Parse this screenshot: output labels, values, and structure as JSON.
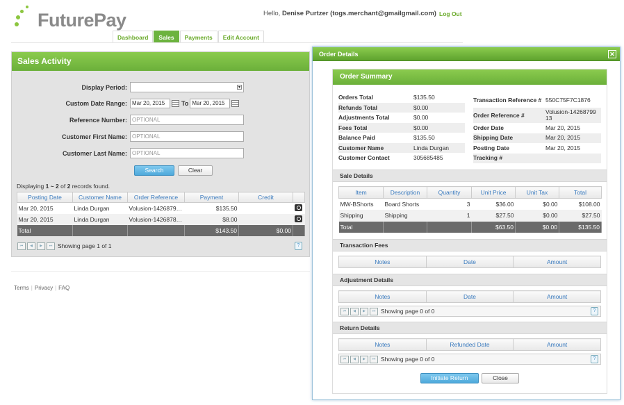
{
  "brand": {
    "logo_text": "FuturePay"
  },
  "header": {
    "greeting_prefix": "Hello,",
    "user": "Denise Purtzer (togs.merchant@gmailgmail.com)",
    "logout": "Log Out"
  },
  "nav": [
    {
      "label": "Dashboard",
      "active": false
    },
    {
      "label": "Sales",
      "active": true
    },
    {
      "label": "Payments",
      "active": false
    },
    {
      "label": "Edit Account",
      "active": false
    }
  ],
  "sales": {
    "title": "Sales Activity",
    "display_period_label": "Display Period:",
    "display_period_value": "",
    "date_range_label": "Custom Date Range:",
    "date_from": "Mar 20, 2015",
    "to_label": "To",
    "date_to": "Mar 20, 2015",
    "ref_label": "Reference Number:",
    "first_label": "Customer First Name:",
    "last_label": "Customer Last Name:",
    "placeholder": "OPTIONAL",
    "search": "Search",
    "clear": "Clear",
    "records_prefix": "Displaying",
    "records_range": "1 ~ 2",
    "records_of": "of",
    "records_total": "2",
    "records_suffix": "records found.",
    "columns": [
      "Posting Date",
      "Customer Name",
      "Order Reference",
      "Payment",
      "Credit"
    ],
    "rows": [
      {
        "date": "Mar 20, 2015",
        "customer": "Linda Durgan",
        "ref": "Volusion-1426879…",
        "payment": "$135.50",
        "credit": ""
      },
      {
        "date": "Mar 20, 2015",
        "customer": "Linda Durgan",
        "ref": "Volusion-1426878…",
        "payment": "$8.00",
        "credit": ""
      }
    ],
    "total": {
      "label": "Total",
      "payment": "$143.50",
      "credit": "$0.00"
    },
    "pager_text": "Showing page 1 of 1"
  },
  "footer": {
    "terms": "Terms",
    "privacy": "Privacy",
    "faq": "FAQ"
  },
  "modal": {
    "title": "Order Details",
    "close_glyph": "✕",
    "summary_title": "Order Summary",
    "summary_left": [
      {
        "k": "Orders Total",
        "v": "$135.50"
      },
      {
        "k": "Refunds Total",
        "v": "$0.00"
      },
      {
        "k": "Adjustments Total",
        "v": "$0.00"
      },
      {
        "k": "Fees Total",
        "v": "$0.00"
      },
      {
        "k": "Balance Paid",
        "v": "$135.50"
      },
      {
        "k": "Customer Name",
        "v": "Linda Durgan"
      },
      {
        "k": "Customer Contact",
        "v": "305685485"
      }
    ],
    "summary_right": [
      {
        "k": "Transaction Reference #",
        "v": "550C75F7C1876"
      },
      {
        "k": "Order Reference #",
        "v": "Volusion-14268799 13"
      },
      {
        "k": "Order Date",
        "v": "Mar 20, 2015"
      },
      {
        "k": "Shipping Date",
        "v": "Mar 20, 2015"
      },
      {
        "k": "Posting Date",
        "v": "Mar 20, 2015"
      },
      {
        "k": "Tracking #",
        "v": ""
      }
    ],
    "sale_details": {
      "title": "Sale Details",
      "columns": [
        "Item",
        "Description",
        "Quantity",
        "Unit Price",
        "Unit Tax",
        "Total"
      ],
      "rows": [
        {
          "item": "MW-BShorts",
          "desc": "Board Shorts",
          "qty": "3",
          "price": "$36.00",
          "tax": "$0.00",
          "total": "$108.00"
        },
        {
          "item": "Shipping",
          "desc": "Shipping",
          "qty": "1",
          "price": "$27.50",
          "tax": "$0.00",
          "total": "$27.50"
        }
      ],
      "total": {
        "label": "Total",
        "price": "$63.50",
        "tax": "$0.00",
        "total": "$135.50"
      }
    },
    "fees": {
      "title": "Transaction Fees",
      "columns": [
        "Notes",
        "Date",
        "Amount"
      ]
    },
    "adjustments": {
      "title": "Adjustment Details",
      "columns": [
        "Notes",
        "Date",
        "Amount"
      ],
      "pager_text": "Showing page 0 of 0"
    },
    "returns": {
      "title": "Return Details",
      "columns": [
        "Notes",
        "Refunded Date",
        "Amount"
      ],
      "pager_text": "Showing page 0 of 0"
    },
    "initiate_return": "Initiate Return",
    "close": "Close"
  },
  "icons": {
    "pager_first": "⏮",
    "pager_prev": "◀",
    "pager_next": "▶",
    "pager_last": "⏭",
    "help": "?"
  },
  "colors": {
    "accent_green": "#6cb33e",
    "link_blue": "#3a7bbf",
    "button_blue": "#4ea9db"
  }
}
